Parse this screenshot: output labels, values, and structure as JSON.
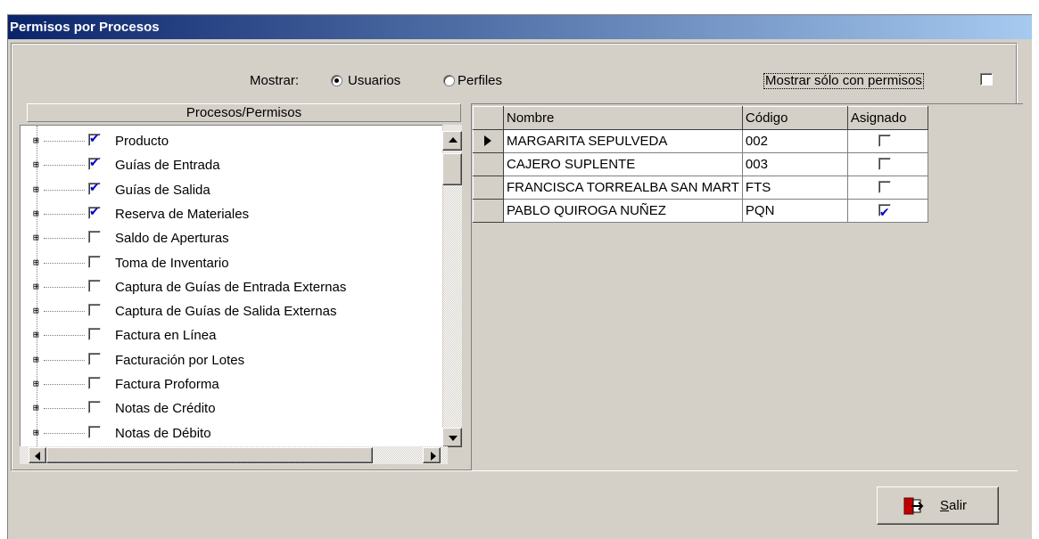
{
  "window": {
    "title": "Permisos por Procesos"
  },
  "filter": {
    "mostrar_label": "Mostrar:",
    "options": [
      {
        "label": "Usuarios",
        "selected": true
      },
      {
        "label": "Perfiles",
        "selected": false
      }
    ],
    "only_with_permissions_label": "Mostrar sólo con permisos",
    "only_with_permissions_checked": false
  },
  "tree": {
    "header": "Procesos/Permisos",
    "items": [
      {
        "label": "Producto",
        "checked": true
      },
      {
        "label": "Guías de Entrada",
        "checked": true
      },
      {
        "label": "Guías de Salida",
        "checked": true
      },
      {
        "label": "Reserva de Materiales",
        "checked": true
      },
      {
        "label": "Saldo de Aperturas",
        "checked": false
      },
      {
        "label": "Toma de Inventario",
        "checked": false
      },
      {
        "label": "Captura de Guías de Entrada Externas",
        "checked": false
      },
      {
        "label": "Captura de Guías de Salida Externas",
        "checked": false
      },
      {
        "label": "Factura en Línea",
        "checked": false
      },
      {
        "label": "Facturación por Lotes",
        "checked": false
      },
      {
        "label": "Factura Proforma",
        "checked": false
      },
      {
        "label": "Notas de Crédito",
        "checked": false
      },
      {
        "label": "Notas de Débito",
        "checked": false
      }
    ]
  },
  "grid": {
    "columns": [
      "Nombre",
      "Código",
      "Asignado"
    ],
    "rows": [
      {
        "nombre": "MARGARITA SEPULVEDA",
        "codigo": "002",
        "asignado": false,
        "current": true
      },
      {
        "nombre": "CAJERO SUPLENTE",
        "codigo": "003",
        "asignado": false,
        "current": false
      },
      {
        "nombre": "FRANCISCA TORREALBA SAN MART",
        "codigo": "FTS",
        "asignado": false,
        "current": false
      },
      {
        "nombre": "PABLO QUIROGA NUÑEZ",
        "codigo": "PQN",
        "asignado": true,
        "current": false
      }
    ]
  },
  "buttons": {
    "salir": "Salir"
  },
  "icons": {
    "salir": "exit-door-icon",
    "tree_expand": "plus-box-icon"
  },
  "colors": {
    "title_start": "#0a246a",
    "title_end": "#a6caf0",
    "check": "#0000cc",
    "face": "#d4d0c8"
  }
}
